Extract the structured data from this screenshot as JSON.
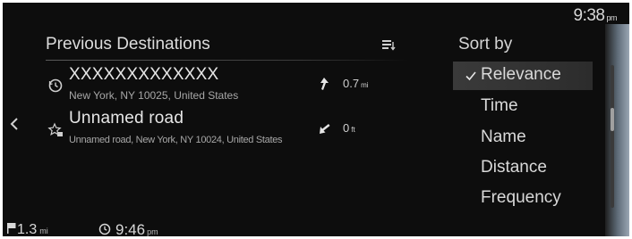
{
  "status": {
    "time": "9:38",
    "ampm": "pm"
  },
  "header": {
    "title": "Previous Destinations",
    "sort_icon": "sort-list-icon"
  },
  "nav": {
    "back_icon": "chevron-left-icon"
  },
  "destinations": [
    {
      "icon": "history-clock-icon",
      "name": "XXXXXXXXXXXXX",
      "address": "New York, NY 10025, United States",
      "direction_icon": "arrow-up-icon",
      "distance": "0.7",
      "distance_unit": "mi"
    },
    {
      "icon": "favorite-star-icon",
      "name": "Unnamed road",
      "address": "Unnamed road, New York, NY 10024, United States",
      "direction_icon": "arrow-down-left-icon",
      "distance": "0",
      "distance_unit": "ft"
    }
  ],
  "sort": {
    "title": "Sort by",
    "options": [
      "Relevance",
      "Time",
      "Name",
      "Distance",
      "Frequency"
    ],
    "selected": "Relevance"
  },
  "footer": {
    "remaining_distance": "1.3",
    "remaining_distance_unit": "mi",
    "arrival_time": "9:46",
    "arrival_ampm": "pm"
  }
}
